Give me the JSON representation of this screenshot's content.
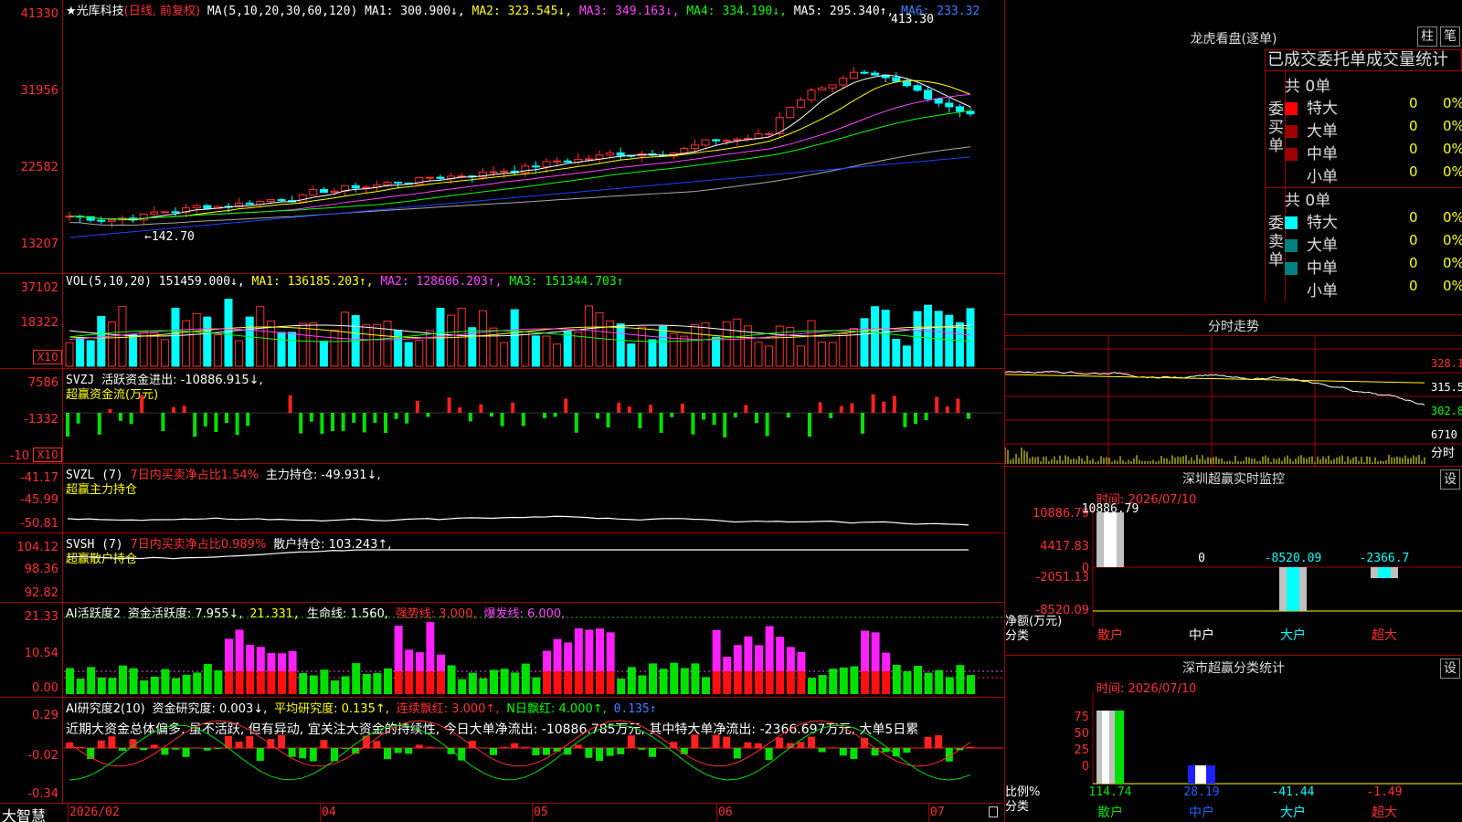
{
  "main": {
    "stock_name": "★光库科技",
    "mode": "(日线, 前复权)",
    "ma_label": "MA(5,10,20,30,60,120)",
    "ma1": "MA1: 300.900↓,",
    "ma2": "MA2: 323.545↓,",
    "ma3": "MA3: 349.163↓,",
    "ma4": "MA4: 334.190↓,",
    "ma5": "MA5: 295.340↑,",
    "ma6": "MA6: 233.32",
    "y_labels": [
      "41330",
      "31956",
      "22582",
      "13207"
    ],
    "high_label": "413.30",
    "low_label": "←142.70"
  },
  "vol": {
    "header": "VOL(5,10,20)",
    "v": "151459.000↓,",
    "ma1": "MA1: 136185.203↑,",
    "ma2": "MA2: 128606.203↑,",
    "ma3": "MA3: 151344.703↑",
    "y_labels": [
      "37102",
      "18322"
    ],
    "x10": "X10"
  },
  "svzj": {
    "header": "SVZJ",
    "label": "活跃资金进出: -10886.915↓,",
    "sub": "超赢资金流(万元)",
    "y_labels": [
      "7586",
      "-1332",
      "-10"
    ],
    "x10": "X10"
  },
  "svzl": {
    "header": "SVZL (7)",
    "ratio": "7日内买卖净占比1.54%",
    "label": "主力持仓: -49.931↓,",
    "sub": "超赢主力持仓",
    "y_labels": [
      "-41.17",
      "-45.99",
      "-50.81"
    ]
  },
  "svsh": {
    "header": "SVSH (7)",
    "ratio": "7日内买卖净占比0.989%",
    "label": "散户持仓: 103.243↑,",
    "sub": "超赢散户持仓",
    "y_labels": [
      "104.12",
      "98.36",
      "92.82"
    ]
  },
  "ai1": {
    "header": "AI活跃度2",
    "label": "资金活跃度: 7.955↓,",
    "v2": "21.331,",
    "life": "生命线: 1.560,",
    "strong": "强势线: 3.000,",
    "burst": "爆发线: 6.000,",
    "y_labels": [
      "21.33",
      "10.54",
      "0.00"
    ]
  },
  "ai2": {
    "header": "AI研究度2(10)",
    "label": "资金研究度: 0.003↓,",
    "avg": "平均研究度: 0.135↑,",
    "cont": "连续飘红: 3.000↑,",
    "nday": "N日飘红: 4.000↑,",
    "last": "0.135↑",
    "text": "近期大资金总体偏多, 虽不活跃, 但有异动, 宜关注大资金的持续性, 今日大单净流出: -10886.785万元, 其中特大单净流出: -2366.697万元, 大单5日累",
    "y_labels": [
      "0.29",
      "-0.02",
      "-0.34"
    ]
  },
  "xaxis": {
    "app": "大智慧",
    "labels": [
      "2026/02",
      "04",
      "05",
      "06",
      "07"
    ]
  },
  "longhu": {
    "title": "龙虎看盘(逐单)",
    "btn1": "柱",
    "btn2": "笔",
    "tabs": "已成交委托单成交量统计",
    "buy_label": "委买单",
    "sell_label": "委卖单",
    "buy_total": "共 0单",
    "sell_total": "共 0单",
    "buy_rows": [
      {
        "name": "特大",
        "v": "0",
        "p": "0%"
      },
      {
        "name": "大单",
        "v": "0",
        "p": "0%"
      },
      {
        "name": "中单",
        "v": "0",
        "p": "0%"
      },
      {
        "name": "小单",
        "v": "0",
        "p": "0%"
      }
    ],
    "sell_rows": [
      {
        "name": "特大",
        "v": "0",
        "p": "0%"
      },
      {
        "name": "大单",
        "v": "0",
        "p": "0%"
      },
      {
        "name": "中单",
        "v": "0",
        "p": "0%"
      },
      {
        "name": "小单",
        "v": "0",
        "p": "0%"
      }
    ],
    "colors": {
      "buy_big": "#ff0000",
      "buy_mid": "#a00000",
      "sell_big": "#00ffff",
      "sell_mid": "#008080"
    }
  },
  "fenshi": {
    "title": "分时走势",
    "y_labels": [
      "328.1",
      "315.5",
      "302.8",
      "6710",
      "分时"
    ]
  },
  "monitor": {
    "title": "深圳超赢实时监控",
    "btn": "设",
    "time": "时间: 2026/07/10",
    "y_labels": [
      "10886.79",
      "4417.83",
      "0",
      "-2051.13",
      "-8520.09"
    ],
    "left_label1": "净额(万元)",
    "left_label2": "分类",
    "values": [
      "10886.79",
      "0",
      "-8520.09",
      "-2366.7"
    ],
    "cats": [
      "散户",
      "中户",
      "大户",
      "超大"
    ]
  },
  "stats": {
    "title": "深市超赢分类统计",
    "btn": "设",
    "time": "时间: 2026/07/10",
    "y_labels": [
      "75",
      "50",
      "25",
      "0"
    ],
    "left_label1": "比例%",
    "left_label2": "分类",
    "values": [
      "114.74",
      "28.19",
      "-41.44",
      "-1.49"
    ],
    "cats": [
      "散户",
      "中户",
      "大户",
      "超大"
    ]
  }
}
